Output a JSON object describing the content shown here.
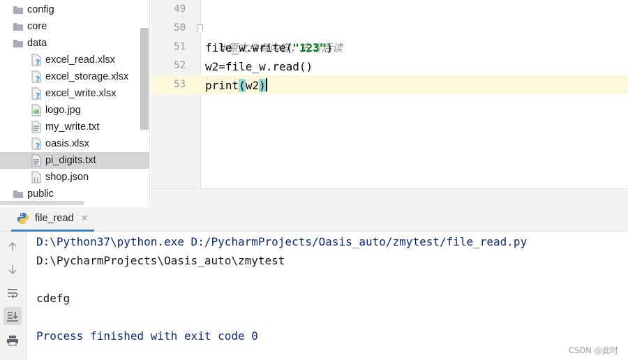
{
  "project_tree": {
    "items": [
      {
        "label": "config",
        "icon": "folder-icon"
      },
      {
        "label": "core",
        "icon": "folder-icon"
      },
      {
        "label": "data",
        "icon": "folder-icon"
      },
      {
        "label": "excel_read.xlsx",
        "icon": "unknown-file-icon"
      },
      {
        "label": "excel_storage.xlsx",
        "icon": "unknown-file-icon"
      },
      {
        "label": "excel_write.xlsx",
        "icon": "unknown-file-icon"
      },
      {
        "label": "logo.jpg",
        "icon": "image-file-icon"
      },
      {
        "label": "my_write.txt",
        "icon": "text-file-icon"
      },
      {
        "label": "oasis.xlsx",
        "icon": "unknown-file-icon"
      },
      {
        "label": "pi_digits.txt",
        "icon": "text-file-icon",
        "selected": true
      },
      {
        "label": "shop.json",
        "icon": "json-file-icon"
      },
      {
        "label": "public",
        "icon": "folder-icon"
      }
    ]
  },
  "editor": {
    "line_numbers": [
      "49",
      "50",
      "51",
      "52",
      "53"
    ],
    "lines": {
      "comment": "#原文件有内容，先写后读",
      "write_prefix": "file_w.write(",
      "write_string": "\"123\"",
      "write_suffix": ")",
      "read_line": "w2=file_w.read()",
      "print_name": "print",
      "print_open": "(",
      "print_arg": "w2",
      "print_close": ")"
    },
    "current_line": "53",
    "colors": {
      "keyword_string": "#067d17",
      "comment": "#8c8c8c",
      "current_line_bg": "#fcf8dc",
      "brace_match": "#93d9d9"
    }
  },
  "run_window": {
    "tab_label": "file_read",
    "tab_close": "✕",
    "toolbar": [
      "up-arrow-icon",
      "down-arrow-icon",
      "soft-wrap-icon",
      "scroll-to-end-icon",
      "print-icon"
    ],
    "console": {
      "command": "D:\\Python37\\python.exe D:/PycharmProjects/Oasis_auto/zmytest/file_read.py",
      "cwd": "D:\\PycharmProjects\\Oasis_auto\\zmytest",
      "output": "cdefg",
      "exit": "Process finished with exit code 0"
    }
  },
  "watermark": "CSDN @此时"
}
